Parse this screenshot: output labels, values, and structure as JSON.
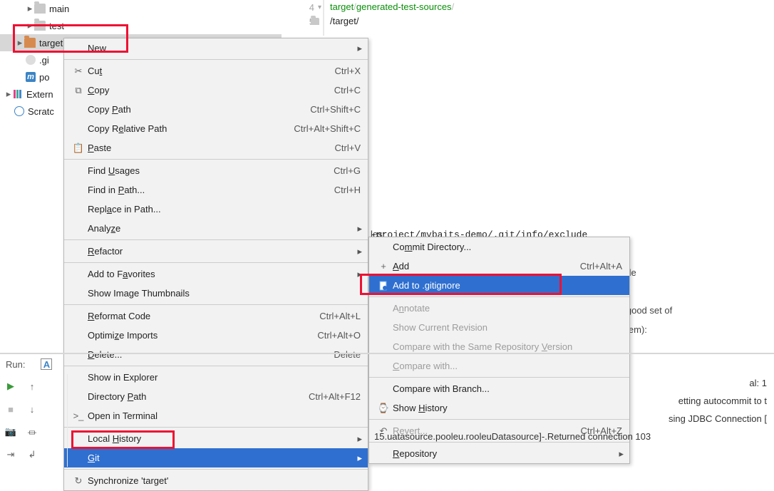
{
  "tree": {
    "main": "main",
    "test": "test",
    "target": "target",
    "gitignore_partial": ".gi",
    "pom_partial": "po",
    "external": "Extern",
    "scratches": "Scratc"
  },
  "editor": {
    "line4": "4",
    "line5": "5",
    "code_line4_a": "target",
    "code_line4_b": "/",
    "code_line4_c": "generated-test-sources",
    "code_line4_d": "/",
    "code_line5": "/target/"
  },
  "menu1": [
    {
      "label": "New",
      "shortcut": "",
      "sub": true,
      "icon": ""
    },
    {
      "sep": true
    },
    {
      "label": "Cut",
      "accel": "t",
      "pre": "Cu",
      "shortcut": "Ctrl+X",
      "icon": "✂"
    },
    {
      "label": "Copy",
      "accel": "C",
      "post": "opy",
      "shortcut": "Ctrl+C",
      "icon": "⧉"
    },
    {
      "label": "Copy Path",
      "accel": "P",
      "pre": "Copy ",
      "post": "ath",
      "shortcut": "Ctrl+Shift+C"
    },
    {
      "label": "Copy Relative Path",
      "pre": "Copy R",
      "accel": "e",
      "post": "lative Path",
      "shortcut": "Ctrl+Alt+Shift+C"
    },
    {
      "label": "Paste",
      "accel": "P",
      "post": "aste",
      "shortcut": "Ctrl+V",
      "icon": "📋"
    },
    {
      "sep": true
    },
    {
      "label": "Find Usages",
      "pre": "Find ",
      "accel": "U",
      "post": "sages",
      "shortcut": "Ctrl+G"
    },
    {
      "label": "Find in Path...",
      "pre": "Find in ",
      "accel": "P",
      "post": "ath...",
      "shortcut": "Ctrl+H"
    },
    {
      "label": "Replace in Path...",
      "pre": "Repl",
      "accel": "a",
      "post": "ce in Path..."
    },
    {
      "label": "Analyze",
      "pre": "Analy",
      "accel": "z",
      "post": "e",
      "sub": true
    },
    {
      "sep": true
    },
    {
      "label": "Refactor",
      "accel": "R",
      "post": "efactor",
      "sub": true
    },
    {
      "sep": true
    },
    {
      "label": "Add to Favorites",
      "pre": "Add to F",
      "accel": "a",
      "post": "vorites",
      "sub": true
    },
    {
      "label": "Show Image Thumbnails"
    },
    {
      "sep": true
    },
    {
      "label": "Reformat Code",
      "accel": "R",
      "post": "eformat Code",
      "shortcut": "Ctrl+Alt+L"
    },
    {
      "label": "Optimize Imports",
      "pre": "Optimi",
      "accel": "z",
      "post": "e Imports",
      "shortcut": "Ctrl+Alt+O"
    },
    {
      "label": "Delete...",
      "accel": "D",
      "post": "elete...",
      "shortcut": "Delete"
    },
    {
      "sep": true
    },
    {
      "label": "Show in Explorer"
    },
    {
      "label": "Directory Path",
      "pre": "Directory ",
      "accel": "P",
      "post": "ath",
      "shortcut": "Ctrl+Alt+F12"
    },
    {
      "label": "Open in Terminal",
      "icon": ">_"
    },
    {
      "sep": true
    },
    {
      "label": "Local History",
      "pre": "Local ",
      "accel": "H",
      "post": "istory",
      "sub": true
    },
    {
      "label": "Git",
      "accel": "G",
      "post": "it",
      "sub": true,
      "selected": true
    },
    {
      "sep": true
    },
    {
      "label": "Synchronize 'target'",
      "icon": "↻"
    }
  ],
  "submenu": {
    "header_path": "-project/mybaits-demo/.git/info/exclude",
    "items": [
      {
        "label": "Commit Directory...",
        "pre": "Co",
        "accel": "m",
        "post": "mit Directory..."
      },
      {
        "label": "Add",
        "accel": "A",
        "post": "dd",
        "icon": "+",
        "shortcut": "Ctrl+Alt+A"
      },
      {
        "label": "Add to .gitignore",
        "icon": "file",
        "selected": true
      },
      {
        "sep": true
      },
      {
        "label": "Annotate",
        "pre": "A",
        "accel": "n",
        "post": "notate",
        "disabled": true
      },
      {
        "label": "Show Current Revision",
        "disabled": true
      },
      {
        "label": "Compare with the Same Repository Version",
        "pre": "Compare with the Same Repository ",
        "accel": "V",
        "post": "ersion",
        "disabled": true
      },
      {
        "label": "Compare with...",
        "accel": "C",
        "post": "ompare with...",
        "disabled": true
      },
      {
        "sep": true
      },
      {
        "label": "Compare with Branch..."
      },
      {
        "label": "Show History",
        "pre": "Show ",
        "accel": "H",
        "post": "istory",
        "icon": "⌚"
      },
      {
        "sep": true
      },
      {
        "label": "Revert...",
        "pre": "Re",
        "accel": "v",
        "post": "ert...",
        "icon": "↶",
        "shortcut": "Ctrl+Alt+Z",
        "disabled": true
      },
      {
        "sep": true
      },
      {
        "label": "Repository",
        "accel": "R",
        "post": "epository",
        "sub": true
      }
    ]
  },
  "bg": {
    "l1": "les:",
    "l2": "ude",
    "l3": "good set of",
    "l4": "them):"
  },
  "run": {
    "label": "Run:",
    "icon_label": "A",
    "c1": "al: 1",
    "c2": "etting autocommit to t",
    "c3": "sing JDBC Connection [",
    "c4": "Returned connection 103",
    "c4_pre": "15.uatasource.pooleu.rooleuDatasource]-."
  }
}
